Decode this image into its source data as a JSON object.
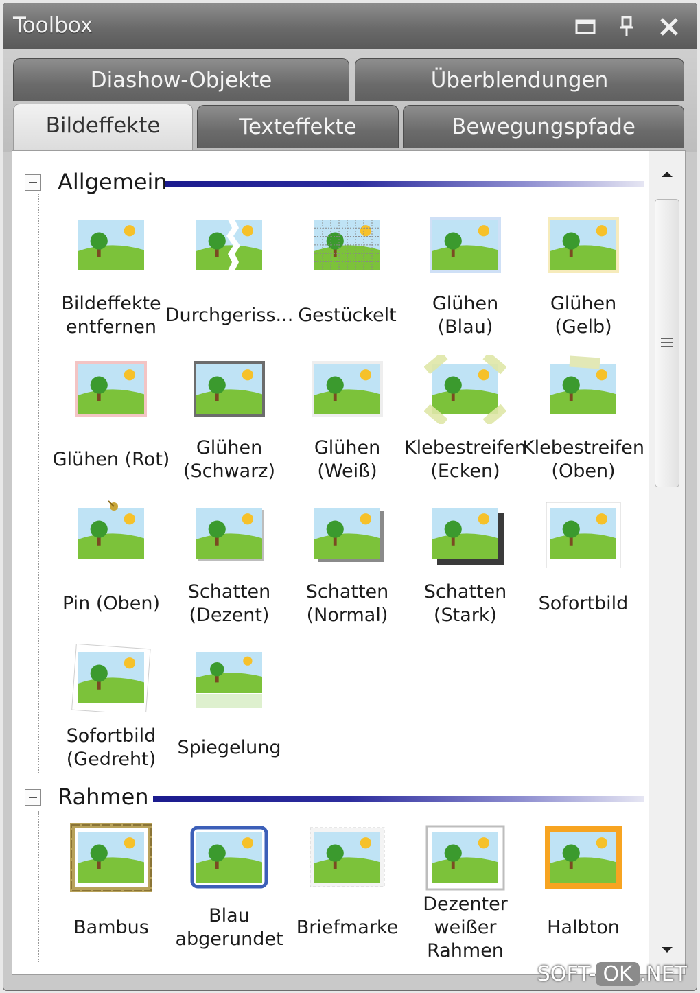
{
  "window": {
    "title": "Toolbox"
  },
  "tabs_row1": [
    {
      "label": "Diashow-Objekte"
    },
    {
      "label": "Überblendungen"
    }
  ],
  "tabs_row2": [
    {
      "label": "Bildeffekte",
      "active": true
    },
    {
      "label": "Texteffekte"
    },
    {
      "label": "Bewegungspfade"
    }
  ],
  "sections": [
    {
      "title": "Allgemein",
      "items": [
        {
          "label": "Bildeffekte entfernen",
          "effect": "none"
        },
        {
          "label": "Durchgeriss...",
          "effect": "torn"
        },
        {
          "label": "Gestückelt",
          "effect": "pieces"
        },
        {
          "label": "Glühen (Blau)",
          "effect": "glow-blue"
        },
        {
          "label": "Glühen (Gelb)",
          "effect": "glow-yellow"
        },
        {
          "label": "Glühen (Rot)",
          "effect": "glow-red"
        },
        {
          "label": "Glühen (Schwarz)",
          "effect": "glow-black"
        },
        {
          "label": "Glühen (Weiß)",
          "effect": "glow-white"
        },
        {
          "label": "Klebestreifen (Ecken)",
          "effect": "tape-corners"
        },
        {
          "label": "Klebestreifen (Oben)",
          "effect": "tape-top"
        },
        {
          "label": "Pin (Oben)",
          "effect": "pin"
        },
        {
          "label": "Schatten (Dezent)",
          "effect": "shadow-light"
        },
        {
          "label": "Schatten (Normal)",
          "effect": "shadow-normal"
        },
        {
          "label": "Schatten (Stark)",
          "effect": "shadow-strong"
        },
        {
          "label": "Sofortbild",
          "effect": "polaroid"
        },
        {
          "label": "Sofortbild (Gedreht)",
          "effect": "polaroid-rotated"
        },
        {
          "label": "Spiegelung",
          "effect": "reflection"
        }
      ]
    },
    {
      "title": "Rahmen",
      "items": [
        {
          "label": "Bambus",
          "effect": "frame-bamboo"
        },
        {
          "label": "Blau abgerundet",
          "effect": "frame-blue"
        },
        {
          "label": "Briefmarke",
          "effect": "frame-stamp"
        },
        {
          "label": "Dezenter weißer Rahmen",
          "effect": "frame-white"
        },
        {
          "label": "Halbton",
          "effect": "frame-orange"
        }
      ]
    }
  ],
  "watermark": {
    "pre": "SOFT-",
    "ok": "OK",
    "post": ".NET"
  },
  "colors": {
    "sky": "#bfe3f5",
    "grass": "#7cc23a",
    "sun": "#f6c12a",
    "tree": "#3b9a2e",
    "trunk": "#7a4a22",
    "section_line": "#1b1b8e"
  }
}
